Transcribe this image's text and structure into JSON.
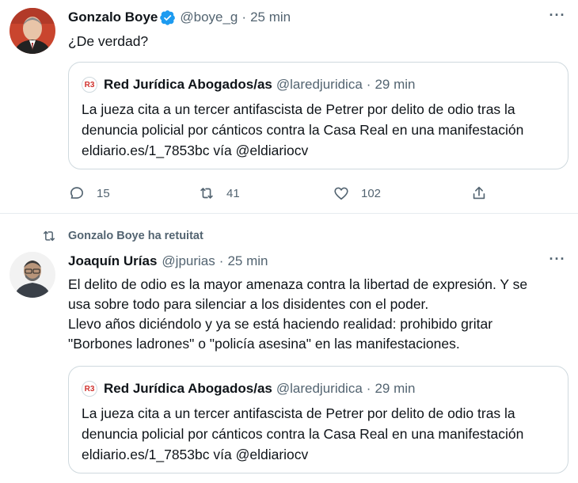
{
  "tweets": [
    {
      "author_name": "Gonzalo Boye",
      "verified": true,
      "handle": "@boye_g",
      "separator": "·",
      "time": "25 min",
      "text": "¿De verdad?",
      "quote": {
        "logo_text": "R3",
        "author_name": "Red Jurídica Abogados/as",
        "handle": "@laredjuridica",
        "separator": "·",
        "time": "29 min",
        "text": "La jueza cita a un tercer antifascista de Petrer por delito de odio tras la denuncia policial por cánticos contra la Casa Real en una manifestación eldiario.es/1_7853bc vía @eldiariocv"
      },
      "actions": {
        "reply_count": "15",
        "retweet_count": "41",
        "like_count": "102"
      }
    },
    {
      "retweeted_by": "Gonzalo Boye ha retuitat",
      "author_name": "Joaquín Urías",
      "handle": "@jpurias",
      "separator": "·",
      "time": "25 min",
      "text_lines": [
        "El delito de odio es la mayor amenaza contra la libertad de expresión. Y se",
        "usa sobre todo para silenciar a los disidentes con el poder.",
        "Llevo años diciéndolo y ya se está haciendo realidad: prohibido gritar",
        "\"Borbones ladrones\" o \"policía asesina\" en las manifestaciones."
      ],
      "quote": {
        "logo_text": "R3",
        "author_name": "Red Jurídica Abogados/as",
        "handle": "@laredjuridica",
        "separator": "·",
        "time": "29 min",
        "text": "La jueza cita a un tercer antifascista de Petrer por delito de odio tras la denuncia policial por cánticos contra la Casa Real en una manifestación eldiario.es/1_7853bc vía @eldiariocv"
      }
    }
  ],
  "icons": {
    "more": "more-icon",
    "verified": "verified-badge-icon",
    "reply": "reply-icon",
    "retweet": "retweet-icon",
    "like": "heart-icon",
    "share": "share-icon"
  },
  "colors": {
    "text": "#0f1419",
    "muted": "#536471",
    "border": "#cfd9de",
    "verified": "#1d9bf0",
    "logo_red": "#d0312d"
  }
}
